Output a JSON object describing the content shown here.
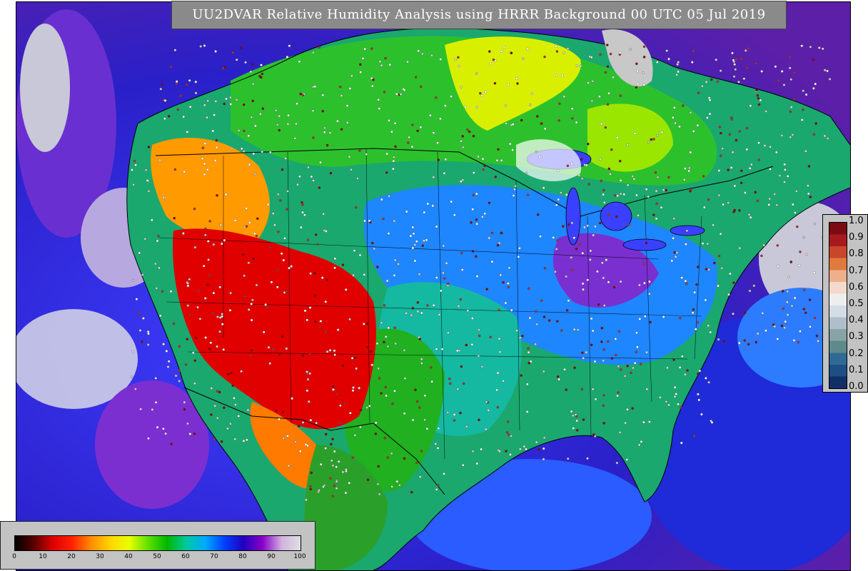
{
  "title": "UU2DVAR Relative Humidity Analysis using HRRR Background 00 UTC 05 Jul 2019",
  "right_legend": {
    "ticks": [
      "1.0",
      "0.9",
      "0.8",
      "0.7",
      "0.6",
      "0.5",
      "0.4",
      "0.3",
      "0.2",
      "0.1",
      "0.0"
    ],
    "colors": [
      "#7a0b12",
      "#a8191f",
      "#c8462a",
      "#e07a3c",
      "#eeb08c",
      "#f4d9cc",
      "#eeeeee",
      "#d2dde6",
      "#aebfca",
      "#86a3a6",
      "#5f8a8c",
      "#2f6a94",
      "#1d4e84",
      "#102f67"
    ]
  },
  "bottom_legend": {
    "ticks": [
      "0",
      "10",
      "20",
      "30",
      "40",
      "50",
      "60",
      "70",
      "80",
      "90",
      "100"
    ],
    "colors": [
      "#000000",
      "#5a0000",
      "#e00000",
      "#ff2200",
      "#ff8c00",
      "#ffd400",
      "#e8ff00",
      "#60e000",
      "#00b800",
      "#00c8a0",
      "#00aaff",
      "#0040ff",
      "#2000c0",
      "#8a00c8",
      "#d0b0e0",
      "#e0e0e0"
    ]
  },
  "map": {
    "colors": {
      "ocean_deep": "#1f1fcf",
      "ocean_mid": "#2f5cff",
      "ocean_purple": "#5b1fa8",
      "dry_red": "#e00000",
      "dry_orange": "#ff9a00",
      "yellow": "#f2e600",
      "green": "#1fb51f",
      "light_green": "#7be01f",
      "teal": "#14b8a0",
      "blue": "#1a7cff",
      "purple": "#7f2fd0",
      "cloud_gray": "#c8c8c8"
    }
  }
}
